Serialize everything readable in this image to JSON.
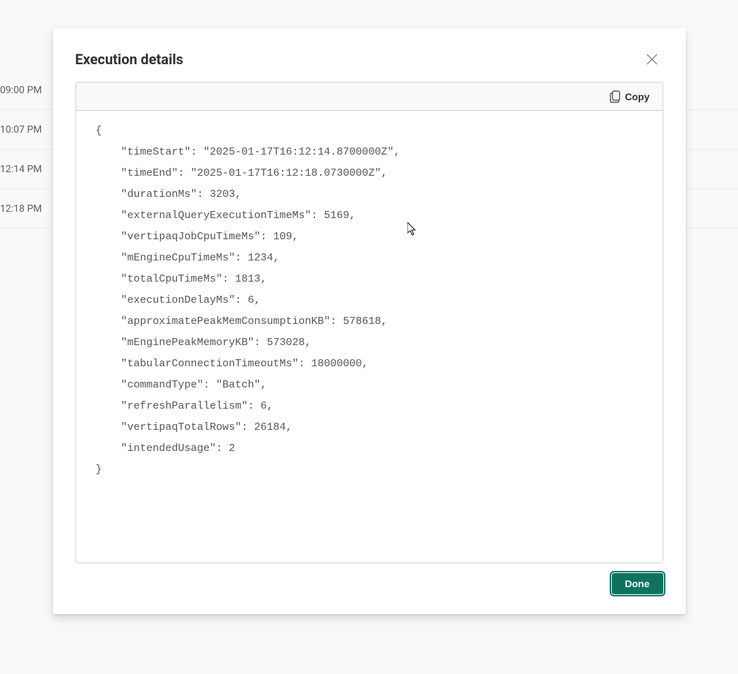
{
  "background": {
    "rows": [
      "09:00 PM",
      "10:07 PM",
      "12:14 PM",
      "12:18 PM"
    ]
  },
  "modal": {
    "title": "Execution details",
    "copy_label": "Copy",
    "done_label": "Done",
    "json_content": {
      "timeStart": "2025-01-17T16:12:14.8700000Z",
      "timeEnd": "2025-01-17T16:12:18.0730000Z",
      "durationMs": 3203,
      "externalQueryExecutionTimeMs": 5169,
      "vertipaqJobCpuTimeMs": 109,
      "mEngineCpuTimeMs": 1234,
      "totalCpuTimeMs": 1813,
      "executionDelayMs": 6,
      "approximatePeakMemConsumptionKB": 578618,
      "mEnginePeakMemoryKB": 573028,
      "tabularConnectionTimeoutMs": 18000000,
      "commandType": "Batch",
      "refreshParallelism": 6,
      "vertipaqTotalRows": 26184,
      "intendedUsage": 2
    }
  }
}
